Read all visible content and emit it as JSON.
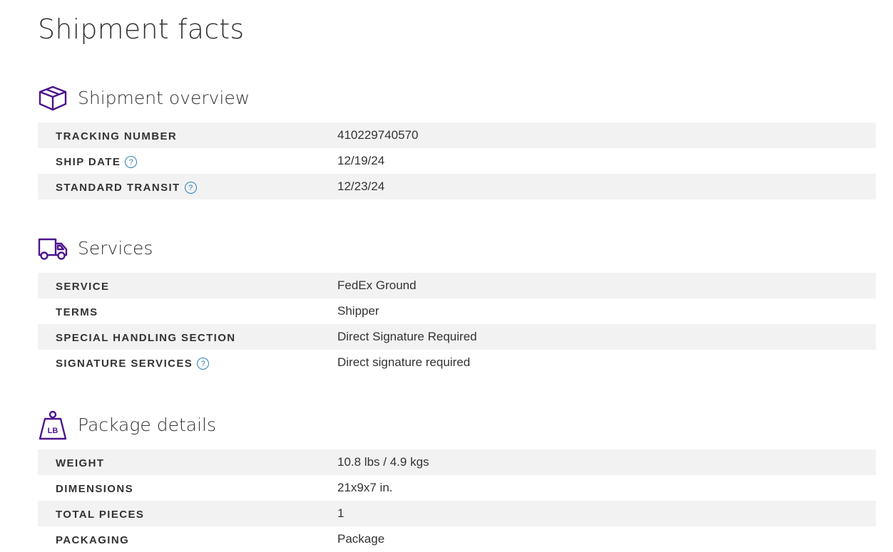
{
  "page": {
    "title": "Shipment facts"
  },
  "colors": {
    "brand_purple": "#4d148c",
    "help_blue": "#2d7fb6",
    "row_shade": "#f2f2f2",
    "text": "#333333"
  },
  "sections": {
    "overview": {
      "icon": "box-icon",
      "title": "Shipment overview",
      "rows": [
        {
          "label": "TRACKING NUMBER",
          "value": "410229740570",
          "help": false
        },
        {
          "label": "SHIP DATE",
          "value": "12/19/24",
          "help": true
        },
        {
          "label": "STANDARD TRANSIT",
          "value": "12/23/24",
          "help": true
        }
      ]
    },
    "services": {
      "icon": "truck-icon",
      "title": "Services",
      "rows": [
        {
          "label": "SERVICE",
          "value": "FedEx Ground",
          "help": false
        },
        {
          "label": "TERMS",
          "value": "Shipper",
          "help": false
        },
        {
          "label": "SPECIAL HANDLING SECTION",
          "value": "Direct Signature Required",
          "help": false
        },
        {
          "label": "SIGNATURE SERVICES",
          "value": "Direct signature required",
          "help": true
        }
      ]
    },
    "package": {
      "icon": "weight-icon",
      "icon_text": "LB",
      "title": "Package details",
      "rows": [
        {
          "label": "WEIGHT",
          "value": "10.8 lbs / 4.9 kgs",
          "help": false
        },
        {
          "label": "DIMENSIONS",
          "value": "21x9x7 in.",
          "help": false
        },
        {
          "label": "TOTAL PIECES",
          "value": "1",
          "help": false
        },
        {
          "label": "PACKAGING",
          "value": "Package",
          "help": false
        }
      ]
    }
  },
  "help_glyph": "?"
}
